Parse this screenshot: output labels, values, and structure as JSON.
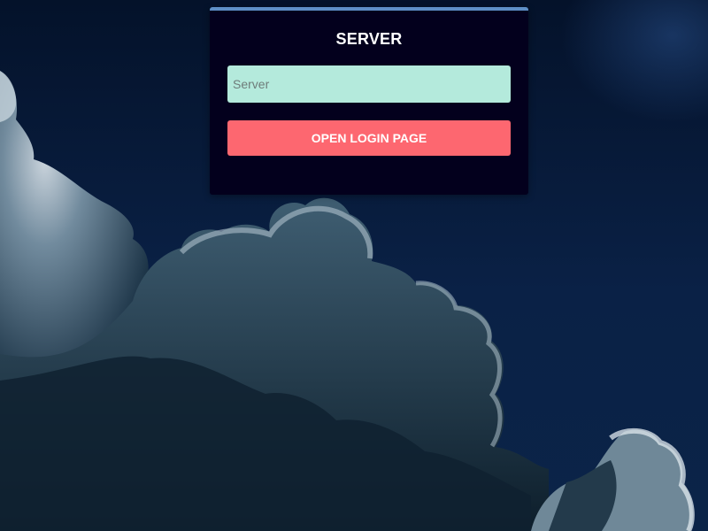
{
  "server_form": {
    "title": "SERVER",
    "server_input": {
      "value": "",
      "placeholder": "Server"
    },
    "open_login_label": "OPEN LOGIN PAGE"
  },
  "colors": {
    "card_background": "#03001d",
    "card_top_border": "#5e8fc6",
    "input_background": "#b4eadc",
    "button_background": "#fd6770",
    "sky": "#0a2146"
  },
  "background": {
    "description_icon": "cloudy-night-sky-image"
  }
}
